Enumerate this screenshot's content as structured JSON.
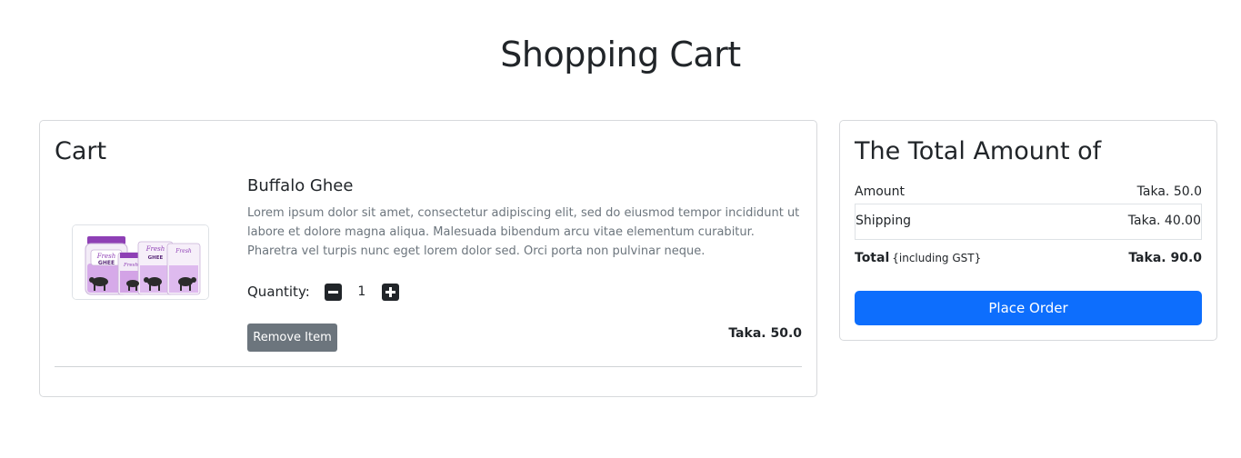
{
  "page": {
    "title": "Shopping Cart"
  },
  "cart": {
    "heading": "Cart",
    "item": {
      "name": "Buffalo Ghee",
      "description": "Lorem ipsum dolor sit amet, consectetur adipiscing elit, sed do eiusmod tempor incididunt ut labore et dolore magna aliqua. Malesuada bibendum arcu vitae elementum curabitur. Pharetra vel turpis nunc eget lorem dolor sed. Orci porta non pulvinar neque.",
      "quantity_label": "Quantity:",
      "quantity": "1",
      "remove_label": "Remove Item",
      "price": "Taka. 50.0",
      "image_alt_brand": "Fresh",
      "image_alt_product": "GHEE"
    }
  },
  "summary": {
    "heading": "The Total Amount of",
    "amount_label": "Amount",
    "amount_value": "Taka. 50.0",
    "shipping_label": "Shipping",
    "shipping_value": "Taka. 40.00",
    "total_label": "Total",
    "total_note": "{including GST}",
    "total_value": "Taka. 90.0",
    "place_order_label": "Place Order"
  },
  "colors": {
    "primary": "#0d6efd",
    "secondary": "#6c757d",
    "dark": "#212529"
  },
  "icons": {
    "decrease": "minus-square-icon",
    "increase": "plus-square-icon"
  }
}
